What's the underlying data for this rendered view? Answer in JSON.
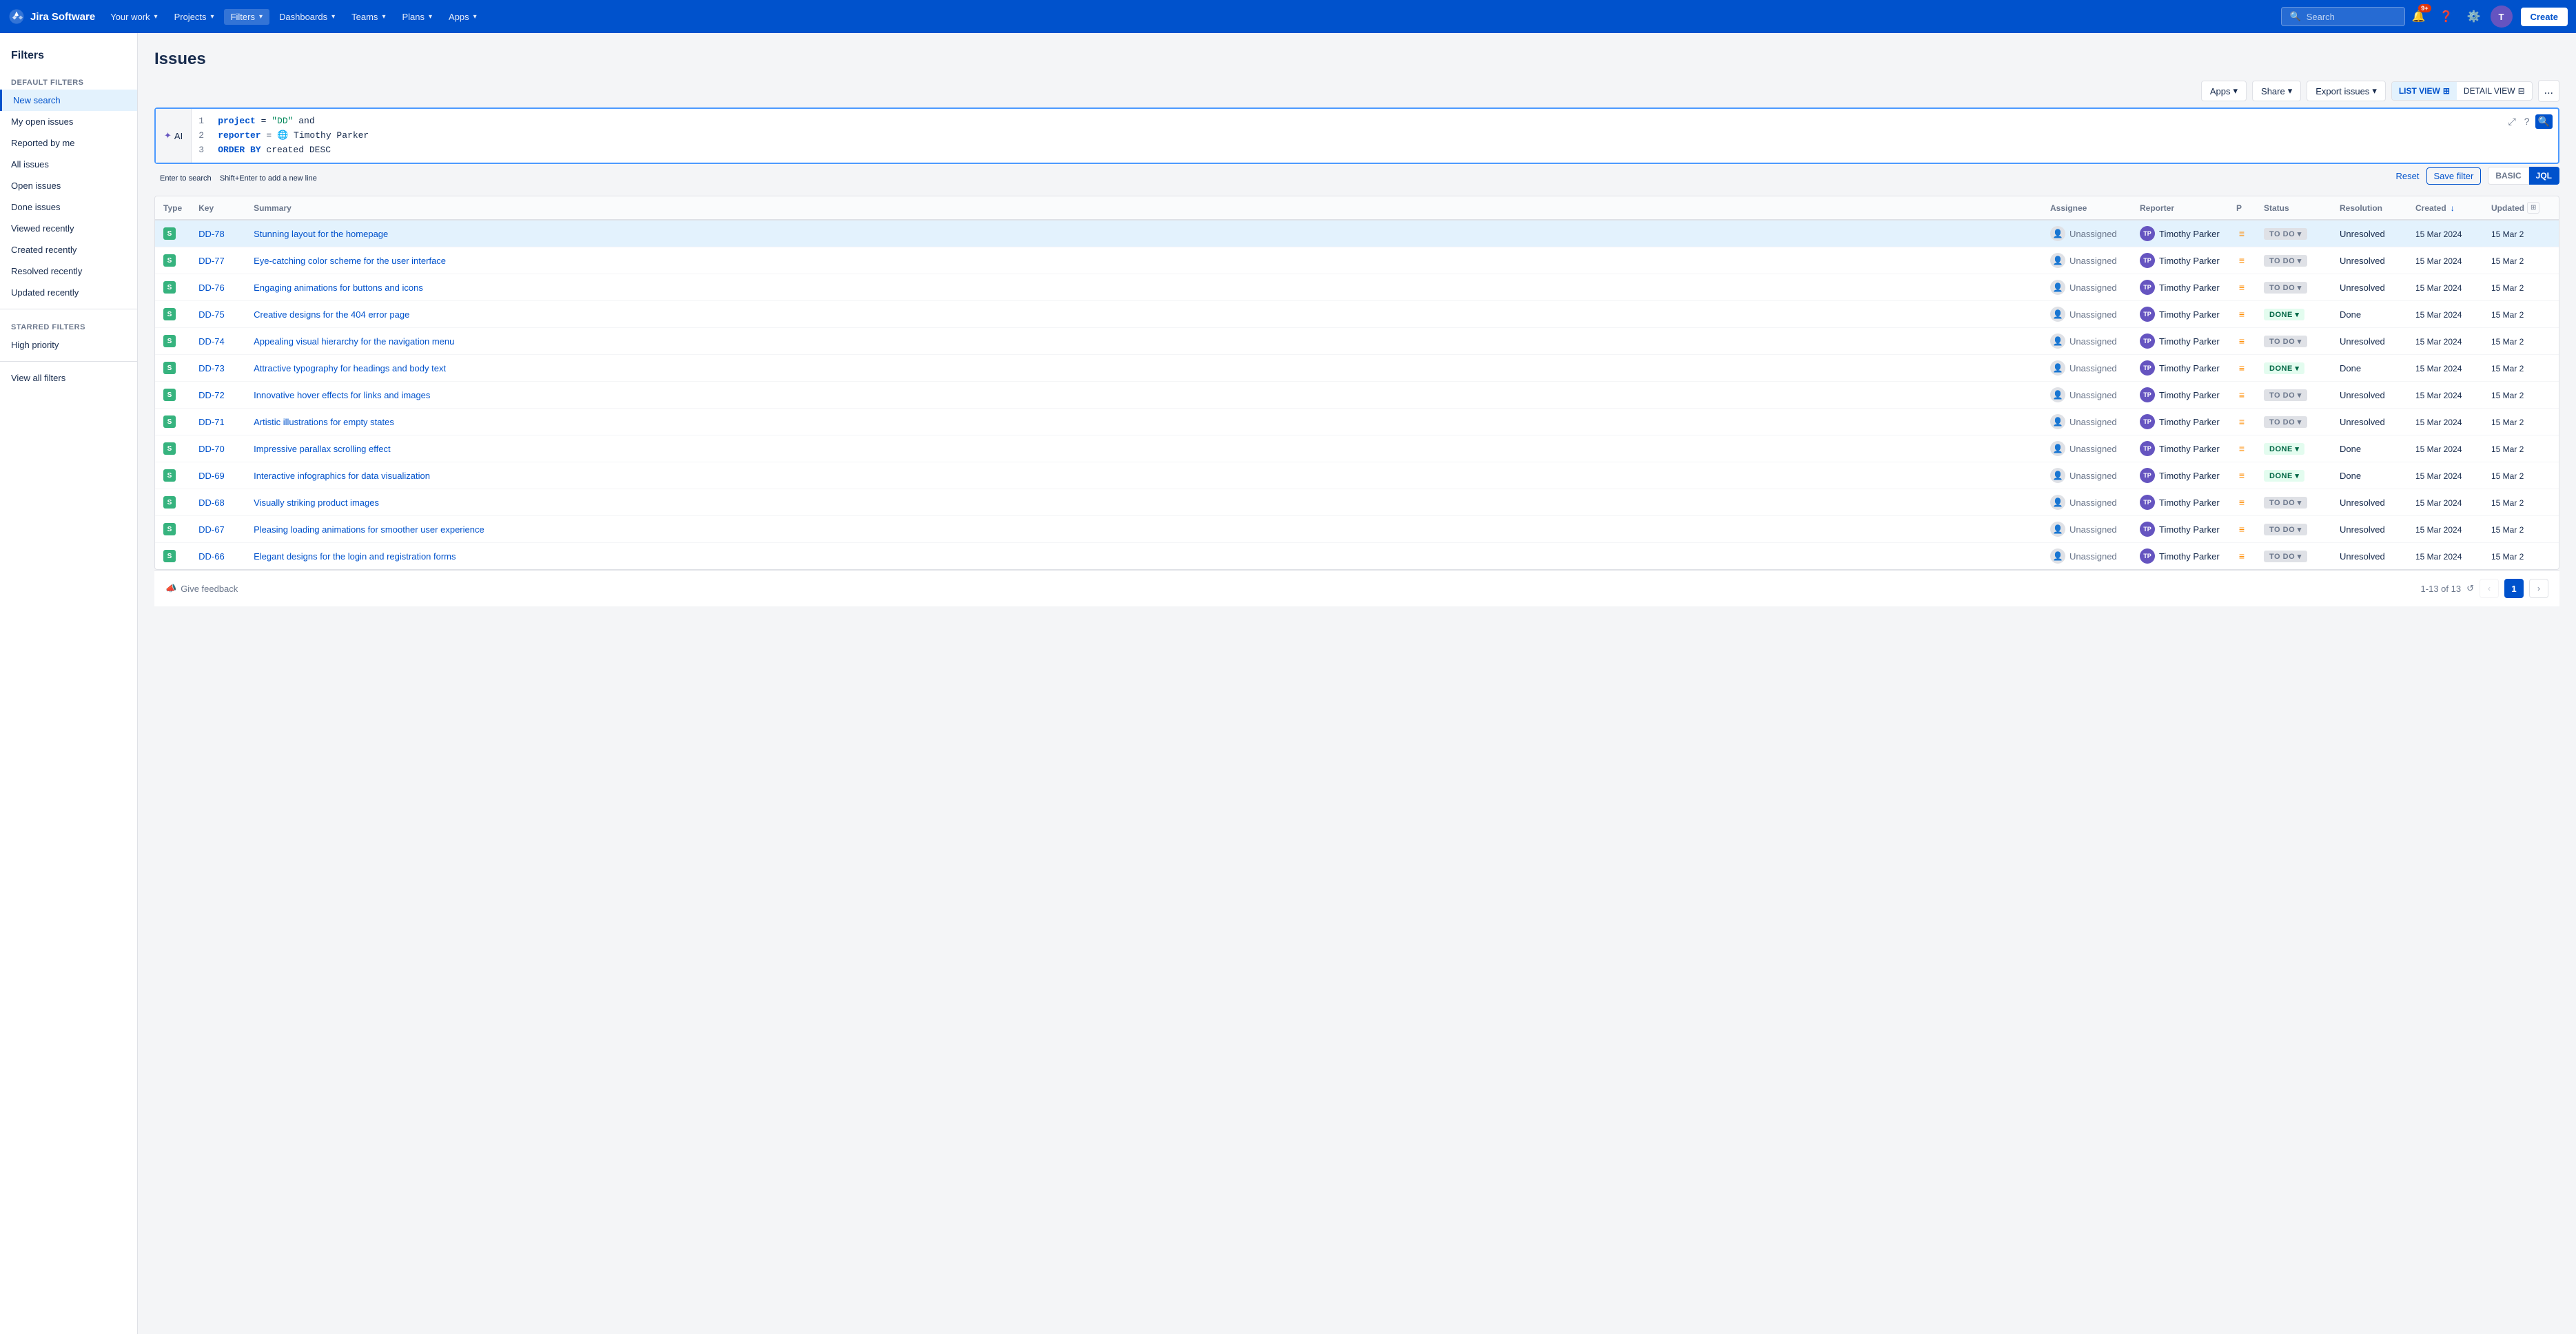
{
  "app": {
    "name": "Jira Software",
    "logo_text": "Jira Software"
  },
  "topnav": {
    "your_work": "Your work",
    "projects": "Projects",
    "filters": "Filters",
    "dashboards": "Dashboards",
    "teams": "Teams",
    "plans": "Plans",
    "apps": "Apps",
    "search_placeholder": "Search",
    "create_label": "Create",
    "notification_count": "9+"
  },
  "sidebar": {
    "title": "Filters",
    "default_filters_label": "DEFAULT FILTERS",
    "starred_filters_label": "STARRED FILTERS",
    "items_default": [
      {
        "id": "new-search",
        "label": "New search",
        "active": true
      },
      {
        "id": "my-open-issues",
        "label": "My open issues",
        "active": false
      },
      {
        "id": "reported-by-me",
        "label": "Reported by me",
        "active": false
      },
      {
        "id": "all-issues",
        "label": "All issues",
        "active": false
      },
      {
        "id": "open-issues",
        "label": "Open issues",
        "active": false
      },
      {
        "id": "done-issues",
        "label": "Done issues",
        "active": false
      },
      {
        "id": "viewed-recently",
        "label": "Viewed recently",
        "active": false
      },
      {
        "id": "created-recently",
        "label": "Created recently",
        "active": false
      },
      {
        "id": "resolved-recently",
        "label": "Resolved recently",
        "active": false
      },
      {
        "id": "updated-recently",
        "label": "Updated recently",
        "active": false
      }
    ],
    "items_starred": [
      {
        "id": "high-priority",
        "label": "High priority",
        "active": false
      }
    ],
    "view_all": "View all filters"
  },
  "page": {
    "title": "Issues"
  },
  "toolbar": {
    "apps_label": "Apps",
    "share_label": "Share",
    "export_label": "Export issues",
    "list_view_label": "LIST VIEW",
    "detail_view_label": "DETAIL VIEW",
    "more_label": "..."
  },
  "query": {
    "ai_label": "AI",
    "lines": [
      {
        "num": "1",
        "code": "project = \"DD\" and"
      },
      {
        "num": "2",
        "code": "reporter = 🌐 Timothy Parker"
      },
      {
        "num": "3",
        "code": "ORDER BY created DESC"
      }
    ],
    "hint_enter": "Enter",
    "hint_enter_text": " to search",
    "hint_shift": "Shift+Enter",
    "hint_shift_text": " to add a new line",
    "reset_label": "Reset",
    "save_filter_label": "Save filter",
    "basic_label": "BASIC",
    "jql_label": "JQL"
  },
  "table": {
    "columns": [
      {
        "id": "type",
        "label": "Type"
      },
      {
        "id": "key",
        "label": "Key"
      },
      {
        "id": "summary",
        "label": "Summary"
      },
      {
        "id": "assignee",
        "label": "Assignee"
      },
      {
        "id": "reporter",
        "label": "Reporter"
      },
      {
        "id": "p",
        "label": "P"
      },
      {
        "id": "status",
        "label": "Status"
      },
      {
        "id": "resolution",
        "label": "Resolution"
      },
      {
        "id": "created",
        "label": "Created",
        "sorted": true,
        "sort_dir": "desc"
      },
      {
        "id": "updated",
        "label": "Updated"
      }
    ],
    "rows": [
      {
        "key": "DD-78",
        "summary": "Stunning layout for the homepage",
        "assignee": "Unassigned",
        "reporter": "Timothy Parker",
        "priority": "medium",
        "status": "TO DO",
        "status_type": "todo",
        "resolution": "Unresolved",
        "created": "15 Mar 2024",
        "updated": "15 Mar 2",
        "selected": true
      },
      {
        "key": "DD-77",
        "summary": "Eye-catching color scheme for the user interface",
        "assignee": "Unassigned",
        "reporter": "Timothy Parker",
        "priority": "medium",
        "status": "TO DO",
        "status_type": "todo",
        "resolution": "Unresolved",
        "created": "15 Mar 2024",
        "updated": "15 Mar 2",
        "selected": false
      },
      {
        "key": "DD-76",
        "summary": "Engaging animations for buttons and icons",
        "assignee": "Unassigned",
        "reporter": "Timothy Parker",
        "priority": "medium",
        "status": "TO DO",
        "status_type": "todo",
        "resolution": "Unresolved",
        "created": "15 Mar 2024",
        "updated": "15 Mar 2",
        "selected": false
      },
      {
        "key": "DD-75",
        "summary": "Creative designs for the 404 error page",
        "assignee": "Unassigned",
        "reporter": "Timothy Parker",
        "priority": "medium",
        "status": "DONE",
        "status_type": "done",
        "resolution": "Done",
        "created": "15 Mar 2024",
        "updated": "15 Mar 2",
        "selected": false
      },
      {
        "key": "DD-74",
        "summary": "Appealing visual hierarchy for the navigation menu",
        "assignee": "Unassigned",
        "reporter": "Timothy Parker",
        "priority": "medium",
        "status": "TO DO",
        "status_type": "todo",
        "resolution": "Unresolved",
        "created": "15 Mar 2024",
        "updated": "15 Mar 2",
        "selected": false
      },
      {
        "key": "DD-73",
        "summary": "Attractive typography for headings and body text",
        "assignee": "Unassigned",
        "reporter": "Timothy Parker",
        "priority": "medium",
        "status": "DONE",
        "status_type": "done",
        "resolution": "Done",
        "created": "15 Mar 2024",
        "updated": "15 Mar 2",
        "selected": false
      },
      {
        "key": "DD-72",
        "summary": "Innovative hover effects for links and images",
        "assignee": "Unassigned",
        "reporter": "Timothy Parker",
        "priority": "medium",
        "status": "TO DO",
        "status_type": "todo",
        "resolution": "Unresolved",
        "created": "15 Mar 2024",
        "updated": "15 Mar 2",
        "selected": false
      },
      {
        "key": "DD-71",
        "summary": "Artistic illustrations for empty states",
        "assignee": "Unassigned",
        "reporter": "Timothy Parker",
        "priority": "medium",
        "status": "TO DO",
        "status_type": "todo",
        "resolution": "Unresolved",
        "created": "15 Mar 2024",
        "updated": "15 Mar 2",
        "selected": false
      },
      {
        "key": "DD-70",
        "summary": "Impressive parallax scrolling effect",
        "assignee": "Unassigned",
        "reporter": "Timothy Parker",
        "priority": "medium",
        "status": "DONE",
        "status_type": "done",
        "resolution": "Done",
        "created": "15 Mar 2024",
        "updated": "15 Mar 2",
        "selected": false
      },
      {
        "key": "DD-69",
        "summary": "Interactive infographics for data visualization",
        "assignee": "Unassigned",
        "reporter": "Timothy Parker",
        "priority": "medium",
        "status": "DONE",
        "status_type": "done",
        "resolution": "Done",
        "created": "15 Mar 2024",
        "updated": "15 Mar 2",
        "selected": false
      },
      {
        "key": "DD-68",
        "summary": "Visually striking product images",
        "assignee": "Unassigned",
        "reporter": "Timothy Parker",
        "priority": "medium",
        "status": "TO DO",
        "status_type": "todo",
        "resolution": "Unresolved",
        "created": "15 Mar 2024",
        "updated": "15 Mar 2",
        "selected": false
      },
      {
        "key": "DD-67",
        "summary": "Pleasing loading animations for smoother user experience",
        "assignee": "Unassigned",
        "reporter": "Timothy Parker",
        "priority": "medium",
        "status": "TO DO",
        "status_type": "todo",
        "resolution": "Unresolved",
        "created": "15 Mar 2024",
        "updated": "15 Mar 2",
        "selected": false
      },
      {
        "key": "DD-66",
        "summary": "Elegant designs for the login and registration forms",
        "assignee": "Unassigned",
        "reporter": "Timothy Parker",
        "priority": "medium",
        "status": "TO DO",
        "status_type": "todo",
        "resolution": "Unresolved",
        "created": "15 Mar 2024",
        "updated": "15 Mar 2",
        "selected": false
      }
    ]
  },
  "footer": {
    "feedback_label": "Give feedback",
    "pagination_text": "1-13 of 13",
    "current_page": "1"
  }
}
